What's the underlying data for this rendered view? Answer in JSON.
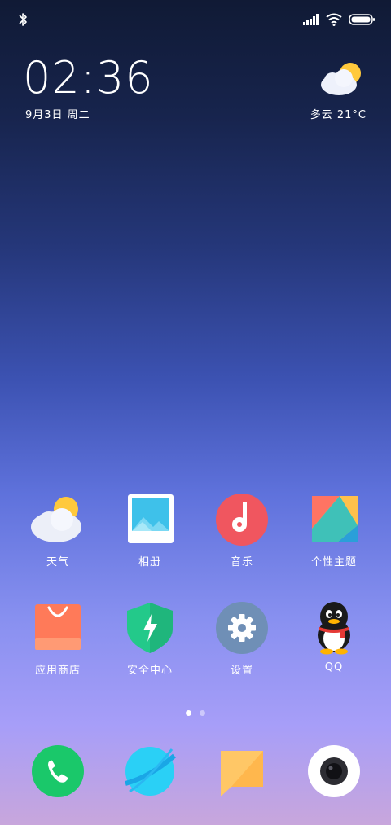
{
  "status_bar": {
    "left_icons": [
      "bluetooth-icon"
    ],
    "right_icons": [
      "cell-signal-icon",
      "wifi-icon",
      "battery-icon"
    ]
  },
  "clock_widget": {
    "time": "02:36",
    "date": "9月3日 周二"
  },
  "weather_widget": {
    "icon": "partly-cloudy-icon",
    "text": "多云  21°C"
  },
  "home_grid": [
    {
      "label": "天气",
      "icon": "weather-app-icon"
    },
    {
      "label": "相册",
      "icon": "gallery-app-icon"
    },
    {
      "label": "音乐",
      "icon": "music-app-icon"
    },
    {
      "label": "个性主题",
      "icon": "themes-app-icon"
    },
    {
      "label": "应用商店",
      "icon": "app-store-icon"
    },
    {
      "label": "安全中心",
      "icon": "security-app-icon"
    },
    {
      "label": "设置",
      "icon": "settings-app-icon"
    },
    {
      "label": "QQ",
      "icon": "qq-app-icon"
    }
  ],
  "page_indicator": {
    "pages": 2,
    "current": 1
  },
  "dock": [
    {
      "icon": "phone-app-icon"
    },
    {
      "icon": "browser-app-icon"
    },
    {
      "icon": "messages-app-icon"
    },
    {
      "icon": "camera-app-icon"
    }
  ],
  "colors": {
    "phone": "#1ac86a",
    "browser": "#2ab8f2",
    "messages": "#ffb74d",
    "music": "#f0565f",
    "security": "#23c98a",
    "settings": "#6f8fb6",
    "store": "#ff7a59"
  }
}
